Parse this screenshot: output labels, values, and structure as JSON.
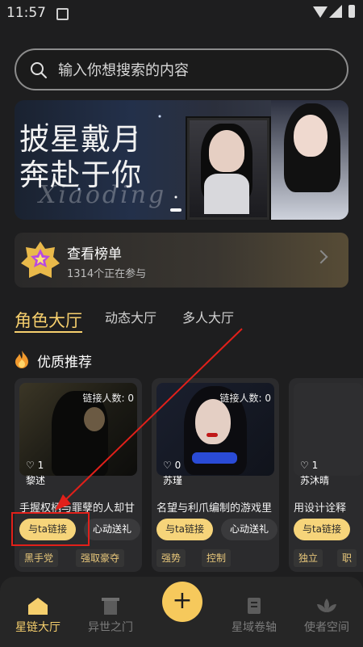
{
  "status": {
    "time": "11:57"
  },
  "search": {
    "placeholder": "输入你想搜索的内容"
  },
  "banner": {
    "line1": "披星戴月",
    "line2": "奔赴于你",
    "script": "Xiaoding"
  },
  "ranking": {
    "title": "查看榜单",
    "subtitle": "1314个正在参与"
  },
  "tabs": [
    {
      "label": "角色大厅",
      "active": true
    },
    {
      "label": "动态大厅",
      "active": false
    },
    {
      "label": "多人大厅",
      "active": false
    }
  ],
  "section": {
    "title": "优质推荐"
  },
  "cards": [
    {
      "count": "链接人数: 0",
      "likes": "1",
      "name": "黎述",
      "desc": "手握权柄与罪孽的人却甘",
      "btn_link": "与ta链接",
      "btn_gift": "心动送礼",
      "tags": [
        "黑手党",
        "强取豪夺"
      ]
    },
    {
      "count": "链接人数: 0",
      "likes": "0",
      "name": "苏瑾",
      "desc": "名望与利爪编制的游戏里",
      "btn_link": "与ta链接",
      "btn_gift": "心动送礼",
      "tags": [
        "强势",
        "控制"
      ]
    },
    {
      "count": "",
      "likes": "1",
      "name": "苏沐晴",
      "desc": "用设计诠释",
      "btn_link": "与ta链接",
      "btn_gift": "",
      "tags": [
        "独立",
        "职"
      ]
    }
  ],
  "nav": [
    {
      "label": "星链大厅",
      "icon": "home-icon",
      "active": true
    },
    {
      "label": "异世之门",
      "icon": "gate-icon",
      "active": false
    },
    {
      "label": "星域卷轴",
      "icon": "scroll-icon",
      "active": false
    },
    {
      "label": "使者空间",
      "icon": "lotus-icon",
      "active": false
    }
  ],
  "fab": {
    "label": "+"
  },
  "colors": {
    "accent": "#f6cf6d",
    "background": "#1e1e1f",
    "highlight": "#e1201a"
  }
}
